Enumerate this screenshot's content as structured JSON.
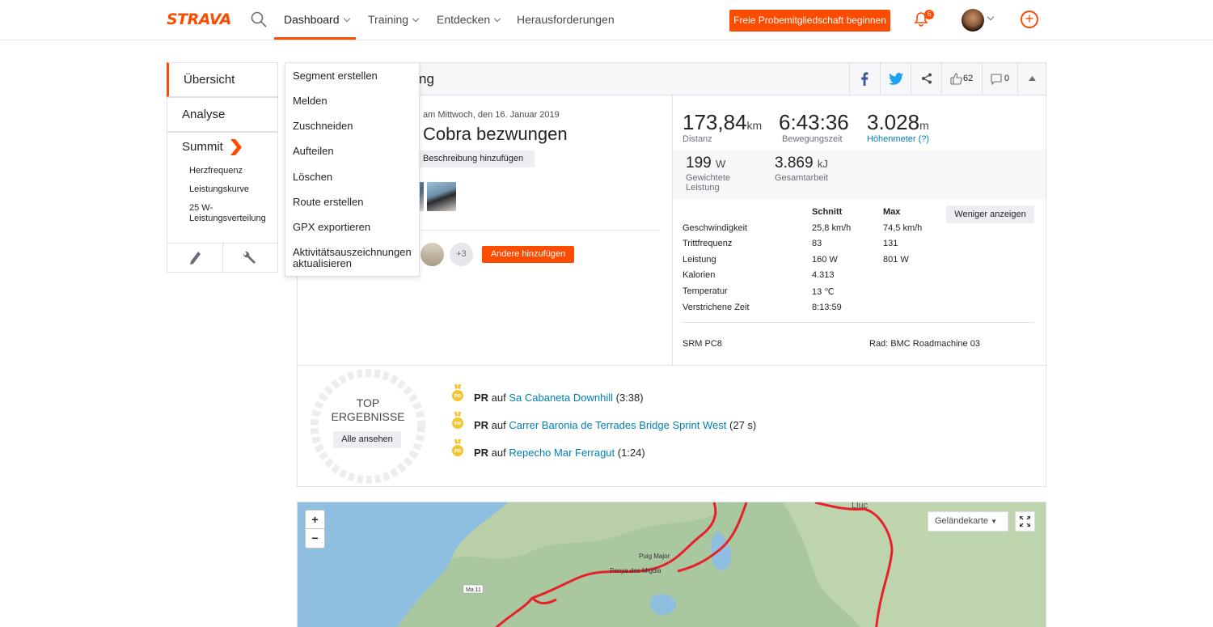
{
  "brand": {
    "logo": "STRAVA",
    "accent": "#fc4c02",
    "link": "#007fb6"
  },
  "nav": {
    "items": [
      "Dashboard",
      "Training",
      "Entdecken",
      "Herausforderungen"
    ],
    "trial_button": "Freie Probemitgliedschaft beginnen",
    "notifications": "6"
  },
  "sidebar": {
    "tabs": [
      "Übersicht",
      "Analyse",
      "Summit"
    ],
    "summit_sub": [
      "Herzfrequenz",
      "Leistungskurve",
      "25 W-Leistungsverteilung"
    ]
  },
  "menu": {
    "items": [
      "Segment erstellen",
      "Melden",
      "Zuschneiden",
      "Aufteilen",
      "Löschen",
      "Route erstellen",
      "GPX exportieren",
      "Aktivitätsauszeichnungen aktualisieren"
    ]
  },
  "activity": {
    "title_fragment": "ng",
    "kudos": "62",
    "comments": "0",
    "date": "am Mittwoch, den 16. Januar 2019",
    "name": "Cobra bezwungen",
    "add_description": "Beschreibung hinzufügen",
    "extra_people": "+3",
    "add_others": "Andere hinzufügen"
  },
  "stats": {
    "distance": {
      "value": "173,84",
      "unit": "km",
      "label": "Distanz"
    },
    "moving_time": {
      "value": "6:43:36",
      "label": "Bewegungszeit"
    },
    "elevation": {
      "value": "3.028",
      "unit": "m",
      "label": "Höhenmeter (?)"
    },
    "weighted_power": {
      "value": "199",
      "unit": "W",
      "label": "Gewichtete Leistung"
    },
    "total_work": {
      "value": "3.869",
      "unit": "kJ",
      "label": "Gesamtarbeit"
    },
    "table_headers": [
      "Schnitt",
      "Max"
    ],
    "less_button": "Weniger anzeigen",
    "rows": [
      {
        "label": "Geschwindigkeit",
        "avg": "25,8 km/h",
        "max": "74,5 km/h"
      },
      {
        "label": "Trittfrequenz",
        "avg": "83",
        "max": "131"
      },
      {
        "label": "Leistung",
        "avg": "160 W",
        "max": "801 W"
      },
      {
        "label": "Kalorien",
        "avg": "4.313",
        "max": ""
      },
      {
        "label": "Temperatur",
        "avg": "13 ℃",
        "max": ""
      },
      {
        "label": "Verstrichene Zeit",
        "avg": "8:13:59",
        "max": ""
      }
    ],
    "device": "SRM PC8",
    "bike": "Rad: BMC Roadmachine 03"
  },
  "top_results": {
    "title_line1": "TOP",
    "title_line2": "ERGEBNISSE",
    "view_all": "Alle ansehen",
    "medal": "PR",
    "items": [
      {
        "prefix": "PR",
        "mid": " auf ",
        "segment": "Sa Cabaneta Downhill",
        "time": " (3:38)"
      },
      {
        "prefix": "PR",
        "mid": " auf ",
        "segment": "Carrer Baronia de Terrades Bridge Sprint West",
        "time": " (27 s)"
      },
      {
        "prefix": "PR",
        "mid": " auf ",
        "segment": "Repecho Mar Ferragut",
        "time": " (1:24)"
      }
    ]
  },
  "map": {
    "type_select": "Geländekarte",
    "zoom_in": "+",
    "zoom_out": "−",
    "labels": [
      "Puig Major",
      "Penya des Migdia",
      "Ma 11",
      "Lluc"
    ]
  }
}
